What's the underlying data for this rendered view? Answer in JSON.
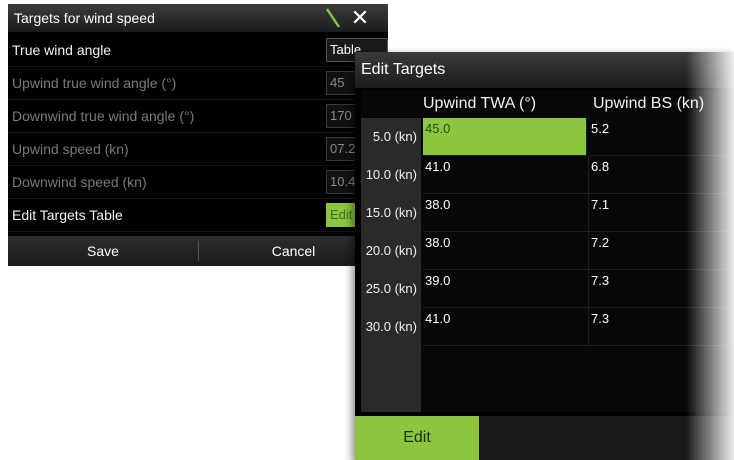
{
  "targets_dialog": {
    "title": "Targets for wind speed",
    "close_symbol": "✕",
    "rows": [
      {
        "label": "True wind angle",
        "value": "Table"
      },
      {
        "label": "Upwind true wind angle (°)",
        "value": "45"
      },
      {
        "label": "Downwind true wind angle (°)",
        "value": "170"
      },
      {
        "label": "Upwind speed (kn)",
        "value": "07.2"
      },
      {
        "label": "Downwind speed (kn)",
        "value": "10.4"
      },
      {
        "label": "Edit Targets Table",
        "value": "Edit"
      }
    ],
    "save_label": "Save",
    "cancel_label": "Cancel"
  },
  "edit_targets": {
    "title": "Edit Targets",
    "columns": [
      "Upwind TWA (°)",
      "Upwind BS (kn)"
    ],
    "rows": [
      {
        "label": "5.0 (kn)",
        "twa": "45.0",
        "bs": "5.2"
      },
      {
        "label": "10.0 (kn)",
        "twa": "41.0",
        "bs": "6.8"
      },
      {
        "label": "15.0 (kn)",
        "twa": "38.0",
        "bs": "7.1"
      },
      {
        "label": "20.0 (kn)",
        "twa": "38.0",
        "bs": "7.2"
      },
      {
        "label": "25.0 (kn)",
        "twa": "39.0",
        "bs": "7.3"
      },
      {
        "label": "30.0 (kn)",
        "twa": "41.0",
        "bs": "7.3"
      }
    ],
    "edit_label": "Edit"
  },
  "colors": {
    "accent": "#8cc63f",
    "background": "#000000"
  }
}
